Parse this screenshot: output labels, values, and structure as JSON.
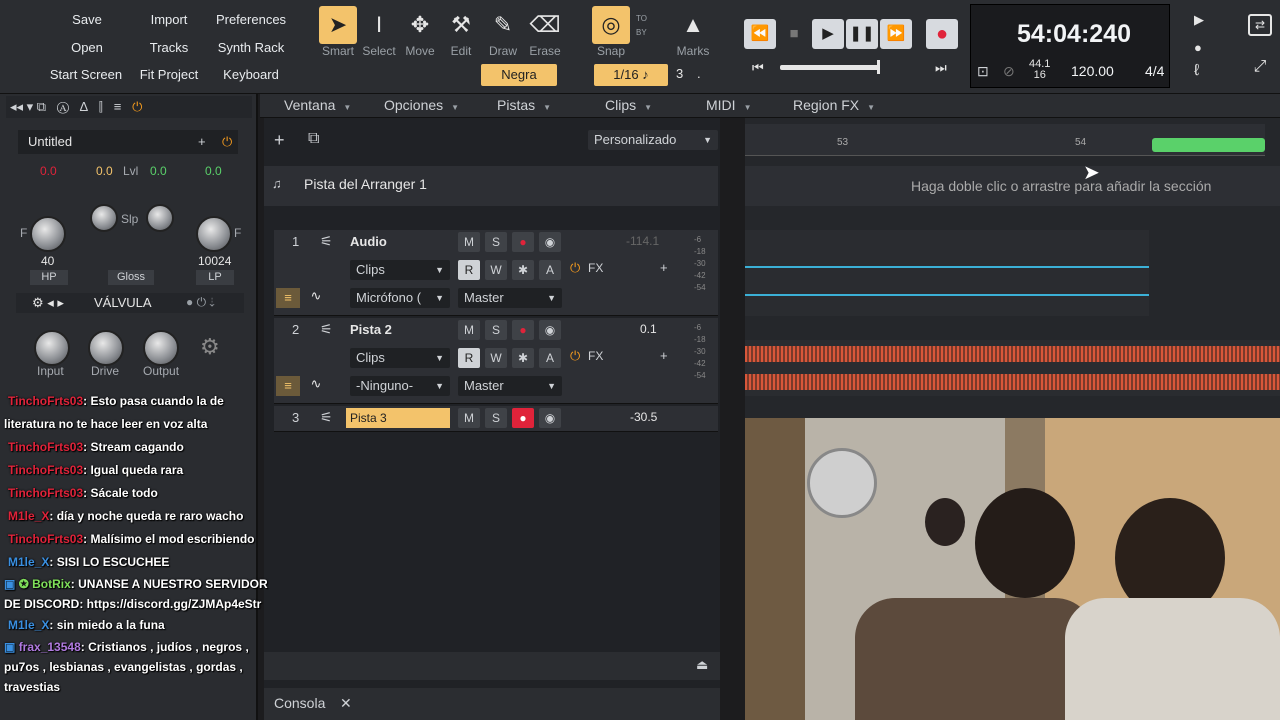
{
  "menu_buttons": {
    "save": "Save",
    "import": "Import",
    "preferences": "Preferences",
    "open": "Open",
    "tracks": "Tracks",
    "synth_rack": "Synth Rack",
    "start_screen": "Start Screen",
    "fit_project": "Fit Project",
    "keyboard": "Keyboard"
  },
  "tools": [
    {
      "label": "Smart",
      "icon": "pointer-icon"
    },
    {
      "label": "Select",
      "icon": "ibeam-icon"
    },
    {
      "label": "Move",
      "icon": "move-icon"
    },
    {
      "label": "Edit",
      "icon": "hammer-icon"
    },
    {
      "label": "Draw",
      "icon": "pencil-icon"
    },
    {
      "label": "Erase",
      "icon": "eraser-icon"
    }
  ],
  "snap": {
    "label": "Snap",
    "value": "1/16",
    "extra": "3",
    "to": "TO",
    "by": "BY"
  },
  "marks": {
    "label": "Marks"
  },
  "color_selector": "Negra",
  "transport": {
    "time": "54:04:240",
    "sample_rate_top": "44.1",
    "sample_rate_bottom": "16",
    "tempo": "120.00",
    "meter": "4/4"
  },
  "menubar": [
    "Ventana",
    "Opciones",
    "Pistas",
    "Clips",
    "MIDI",
    "Region FX"
  ],
  "inspector": {
    "title": "Untitled",
    "gain_left": "0.0",
    "gain_mid": "0.0",
    "lvl_label": "Lvl",
    "lvl_value": "0.0",
    "gain_right": "0.0",
    "slp": "Slp",
    "hp_value": "40",
    "lp_value": "10024",
    "hp": "HP",
    "gloss": "Gloss",
    "lp": "LP",
    "fx_name": "VÁLVULA",
    "knobs": [
      "Input",
      "Drive",
      "Output"
    ],
    "f_left": "F",
    "f_right": "F"
  },
  "track_header": {
    "preset": "Personalizado",
    "arranger": "Pista del Arranger 1",
    "hint": "Haga doble clic o arrastre para añadir la sección",
    "ruler": [
      "53",
      "54"
    ]
  },
  "tracks": [
    {
      "num": "1",
      "name": "Audio",
      "clips": "Clips",
      "input": "Micrófono (",
      "output": "Master",
      "volume": "-114.1",
      "fx": "FX",
      "m": "M",
      "s": "S",
      "r": "R",
      "w": "W",
      "a": "A"
    },
    {
      "num": "2",
      "name": "Pista 2",
      "clips": "Clips",
      "input": "-Ninguno-",
      "output": "Master",
      "volume": "0.1",
      "fx": "FX",
      "m": "M",
      "s": "S",
      "r": "R",
      "w": "W",
      "a": "A"
    },
    {
      "num": "3",
      "name": "Pista 3",
      "volume": "-30.5",
      "m": "M",
      "s": "S"
    }
  ],
  "meter_ticks": [
    "-6",
    "-18",
    "-30",
    "-42",
    "-54"
  ],
  "console": "Consola",
  "chat": [
    {
      "user": "TinchoFrts03",
      "color": "#e0233a",
      "text": ": Esto pasa cuando la de literatura no te hace leer en voz alta"
    },
    {
      "user": "TinchoFrts03",
      "color": "#e0233a",
      "text": ": Stream cagando"
    },
    {
      "user": "TinchoFrts03",
      "color": "#e0233a",
      "text": ": Igual queda rara"
    },
    {
      "user": "TinchoFrts03",
      "color": "#e0233a",
      "text": ": Sácale todo"
    },
    {
      "user": "M1le_X",
      "color": "#e0233a",
      "text": ": día y noche queda re raro wacho"
    },
    {
      "user": "TinchoFrts03",
      "color": "#e0233a",
      "text": ": Malísimo el mod escribiendo"
    },
    {
      "user": "M1le_X",
      "color": "#3a8fe0",
      "text": ": SISI LO ESCUCHEE"
    },
    {
      "user": "BotRix",
      "color": "#7fe05a",
      "text": ": UNANSE A NUESTRO SERVIDOR DE DISCORD: https://discord.gg/ZJMAp4eStr"
    },
    {
      "user": "M1le_X",
      "color": "#3a8fe0",
      "text": ": sin miedo a la funa"
    },
    {
      "user": "frax_13548",
      "color": "#b07ae0",
      "text": ": Cristianos , judíos , negros , pu7os , lesbianas , evangelistas , gordas , travestias"
    }
  ]
}
